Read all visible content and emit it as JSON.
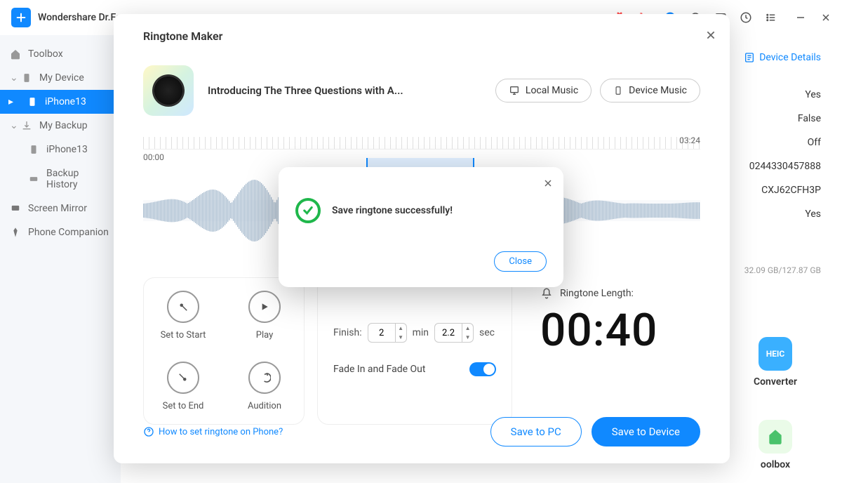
{
  "app": {
    "title": "Wondershare Dr.Fone"
  },
  "sidebar": {
    "toolbox": "Toolbox",
    "my_device": "My Device",
    "iphone13": "iPhone13",
    "my_backup": "My Backup",
    "backup_iphone13": "iPhone13",
    "backup_history": "Backup History",
    "screen_mirror": "Screen Mirror",
    "phone_companion": "Phone Companion"
  },
  "bg": {
    "device_details": "Device Details",
    "values": [
      "Yes",
      "False",
      "Off",
      "0244330457888",
      "CXJ62CFH3P",
      "Yes"
    ],
    "storage": "32.09 GB/127.87 GB",
    "tile1": "Converter",
    "tile1_icon_text": "HEIC",
    "tile2": "oolbox"
  },
  "modal": {
    "title": "Ringtone Maker",
    "song_title": "Introducing The Three Questions with A...",
    "local_music": "Local Music",
    "device_music": "Device Music",
    "time_start": "00:00",
    "time_end": "03:24",
    "set_to_start": "Set to Start",
    "play": "Play",
    "set_to_end": "Set to End",
    "audition": "Audition",
    "finish_label": "Finish:",
    "finish_min": "2",
    "finish_min_unit": "min",
    "finish_sec": "2.2",
    "finish_sec_unit": "sec",
    "fade_label": "Fade In and Fade Out",
    "ringtone_length_label": "Ringtone Length:",
    "ringtone_length": "00:40",
    "help_link": "How to set ringtone on Phone?",
    "save_to_pc": "Save to PC",
    "save_to_device": "Save to Device"
  },
  "dialog": {
    "message": "Save ringtone successfully!",
    "close": "Close"
  }
}
